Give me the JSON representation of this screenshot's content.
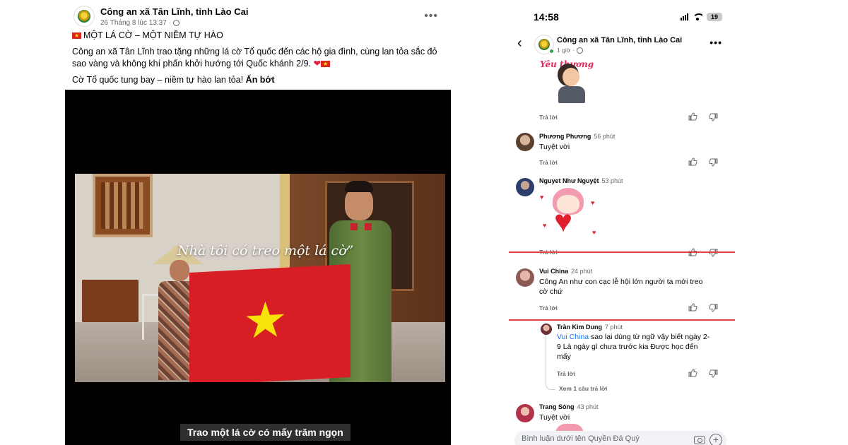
{
  "post": {
    "page_name": "Công an xã Tân Lĩnh, tỉnh Lào Cai",
    "timestamp": "26 Tháng 8 lúc 13:37",
    "headline": "MỘT LÁ CỜ – MỘT NIỀM TỰ HÀO",
    "body": "Công an xã Tân Lĩnh trao tặng những lá cờ Tổ quốc đến các hộ gia đình, cùng lan tỏa sắc đỏ sao vàng và không khí phấn khởi hướng tới Quốc khánh 2/9.",
    "tagline": "Cờ Tổ quốc tung bay – niềm tự hào lan tỏa!",
    "see_less": "Ẩn bớt",
    "more_icon": "more-dots-icon",
    "video": {
      "overlay_text": "Nhà tôi có treo một lá cờ”",
      "subtitle": "Trao một lá cờ có mấy trăm ngọn"
    }
  },
  "phone": {
    "status": {
      "time": "14:58",
      "battery": "19"
    },
    "header": {
      "page_name": "Công an xã Tân Lĩnh, tỉnh Lào Cai",
      "time_ago": "1 giờ"
    },
    "sticker_top_text": "Yêu thương",
    "comments": [
      {
        "name": "Phương Phương",
        "time": "56 phút",
        "text": "Tuyệt vời",
        "reply": "Trả lời"
      },
      {
        "name": "Nguyet Như Nguyệt",
        "time": "53 phút",
        "text": "",
        "reply": "Trả lời"
      },
      {
        "name": "Vui China",
        "time": "24 phút",
        "text": "Công An như con cạc lễ hội lớn người ta mới treo cờ chứ",
        "reply": "Trả lời"
      },
      {
        "name": "Trần Kim Dung",
        "time": "7 phút",
        "mention": "Vui China",
        "text": " sao  lại dùng từ ngữ vậy biết ngày 2-9 Là ngày gì chưa trước kia Được học  đến mấy",
        "reply": "Trả lời"
      },
      {
        "name": "Trang Sóng",
        "time": "43 phút",
        "text": "Tuyệt vời",
        "reply": "Trả lời"
      }
    ],
    "first_reply_label": "Trả lời",
    "see_replies": "Xem 1 câu trả lời",
    "comment_placeholder": "Bình luận dưới tên Quyền Đá Quý",
    "colors": {
      "highlight": "#e0443b",
      "mention": "#1877f2",
      "online": "#31a24c"
    }
  }
}
